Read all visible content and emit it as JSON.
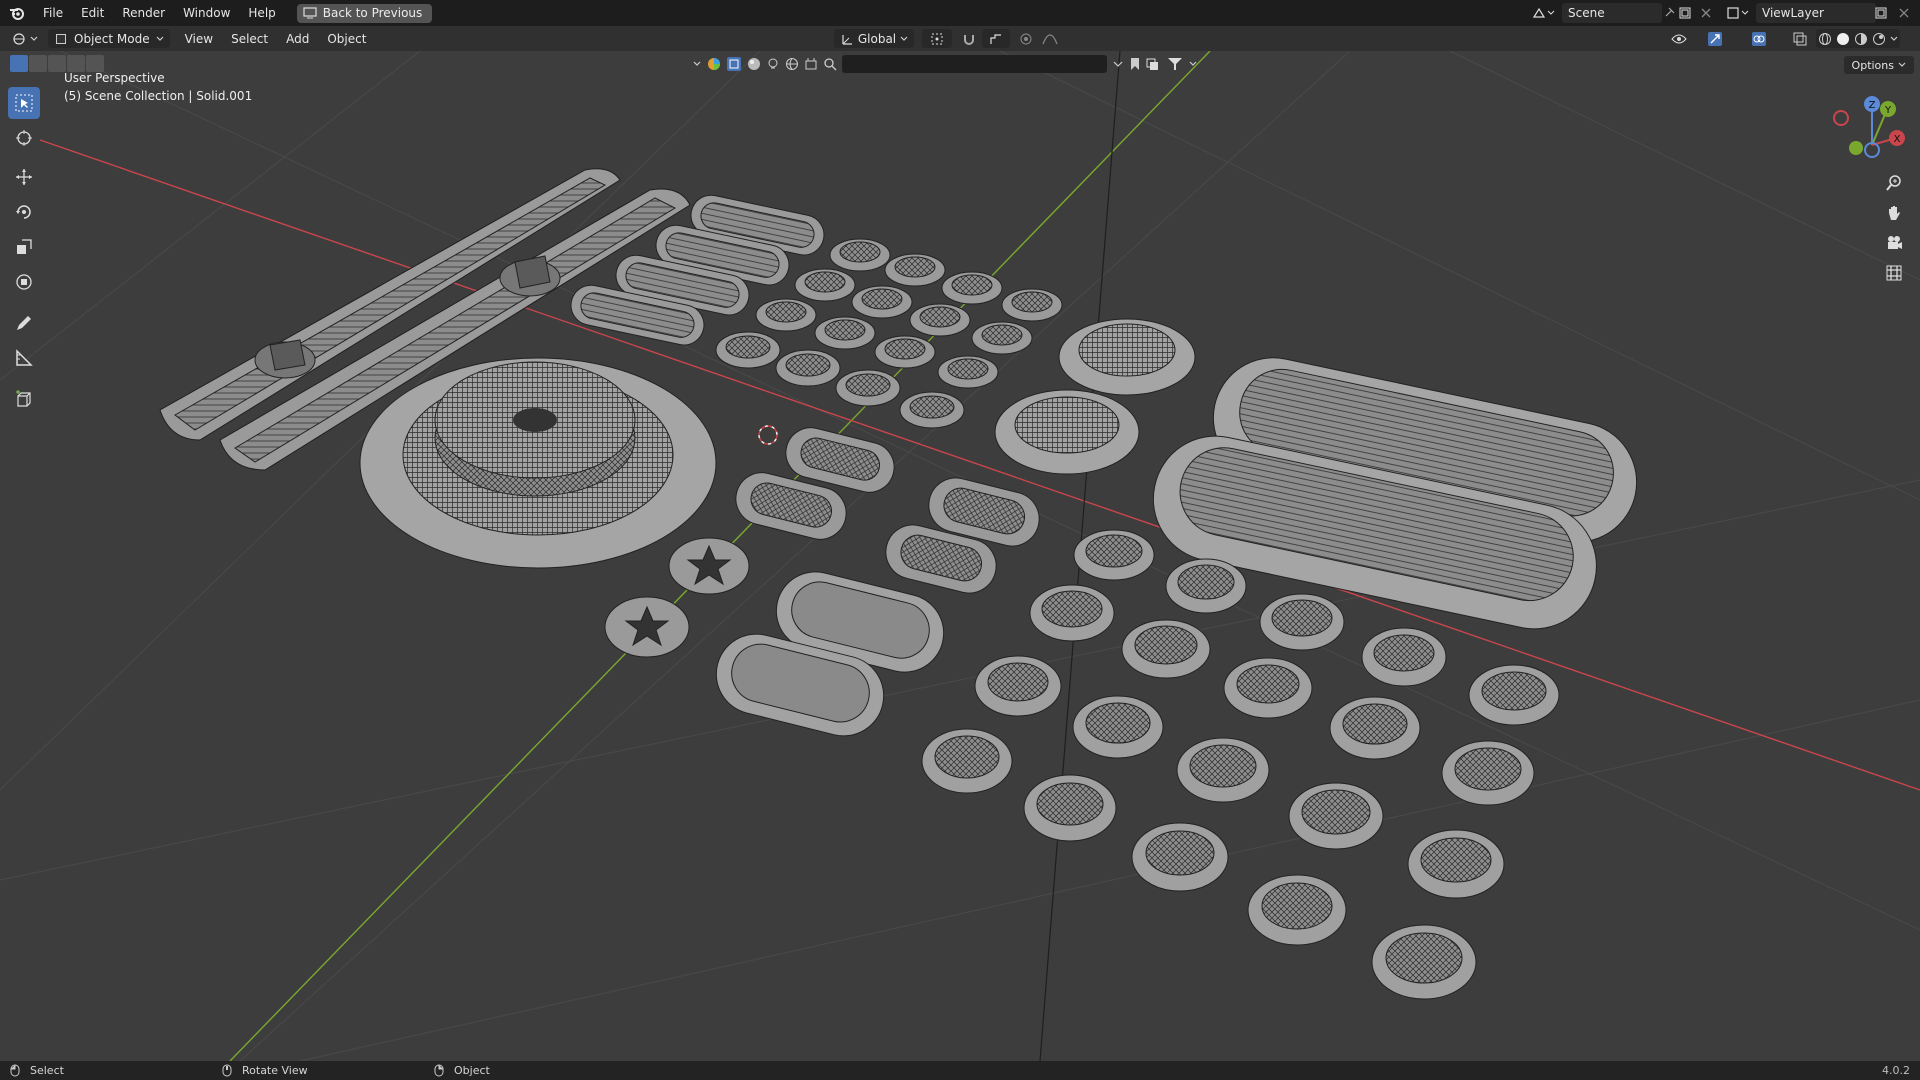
{
  "topbar": {
    "menus": [
      "File",
      "Edit",
      "Render",
      "Window",
      "Help"
    ],
    "back_button": "Back to Previous",
    "scene_name": "Scene",
    "view_layer": "ViewLayer"
  },
  "header": {
    "mode": "Object Mode",
    "menus": [
      "View",
      "Select",
      "Add",
      "Object"
    ],
    "transform_orientation": "Global",
    "options_label": "Options"
  },
  "viewport": {
    "perspective_label": "User Perspective",
    "collection_label": "(5) Scene Collection | Solid.001",
    "gizmo_axes": [
      "X",
      "Y",
      "Z"
    ]
  },
  "statusbar": {
    "left": "Select",
    "middle": "Rotate View",
    "right": "Object",
    "version": "4.0.2"
  },
  "colors": {
    "x_axis": "#c8464c",
    "y_axis": "#7aa82e",
    "selection_blue": "#4772b3"
  }
}
